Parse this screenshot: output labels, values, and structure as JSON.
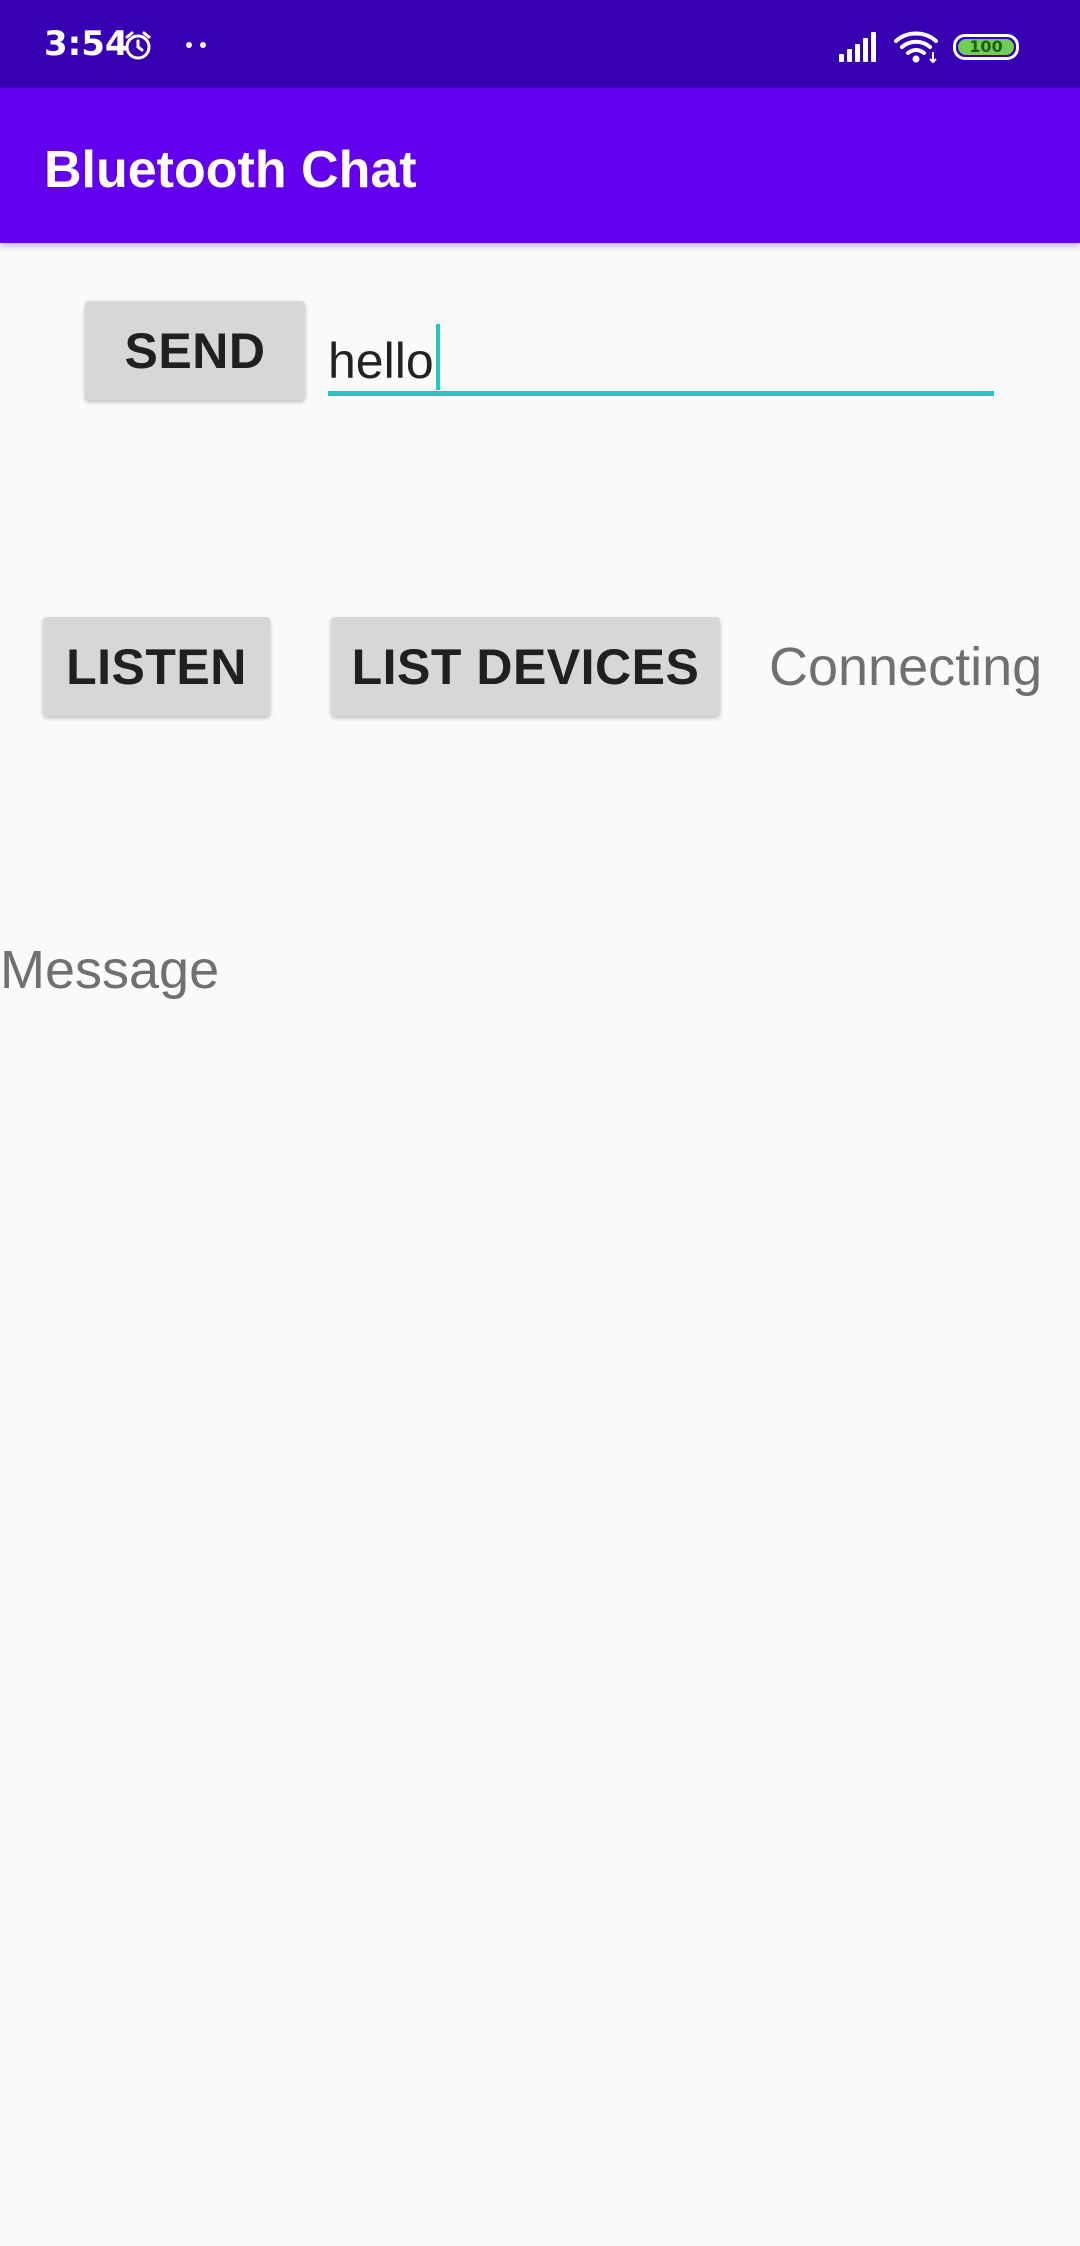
{
  "status_bar": {
    "time": "3:54",
    "alarm_icon": "alarm-clock-icon",
    "notification_dots_icon": "more-notifications-icon",
    "signal_icon": "cell-signal-icon",
    "wifi_icon": "wifi-icon",
    "battery_level": "100",
    "battery_color": "#6fcf52"
  },
  "app_bar": {
    "title": "Bluetooth Chat",
    "color": "#6200ee"
  },
  "send_row": {
    "send_label": "SEND",
    "input_value": "hello",
    "input_accent": "#22c7c0"
  },
  "controls": {
    "listen_label": "LISTEN",
    "list_devices_label": "LIST DEVICES",
    "status_text": "Connecting"
  },
  "message": {
    "placeholder": "Message"
  }
}
